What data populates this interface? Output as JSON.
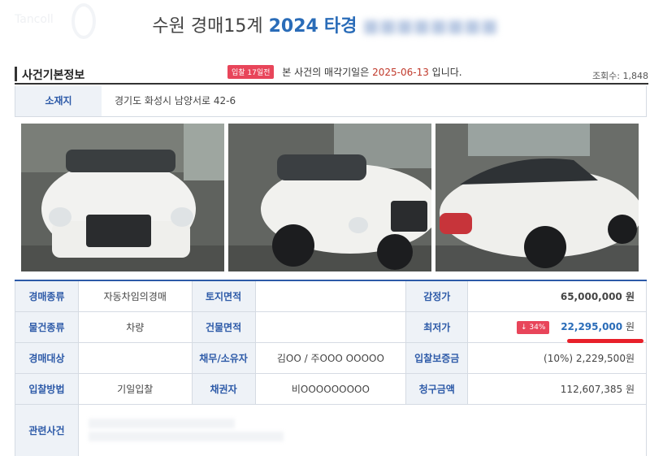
{
  "page": {
    "title_prefix": "수원 경매15계",
    "title_year": "2024",
    "title_suffix": "타경"
  },
  "header": {
    "section_title": "사건기본정보",
    "badge": "입찰 17일전",
    "notice_prefix": "본 사건의 매각기일은",
    "sale_date": "2025-06-13",
    "notice_suffix": "입니다.",
    "views": "조회수: 1,848"
  },
  "location": {
    "label": "소재지",
    "address": "경기도 화성시 남양서로 42-6"
  },
  "photos": [
    {
      "alt": "white car front view"
    },
    {
      "alt": "white car side front view"
    },
    {
      "alt": "white car rear view"
    }
  ],
  "details": {
    "auction_type_label": "경매종류",
    "auction_type": "자동차임의경매",
    "land_area_label": "토지면적",
    "land_area": "",
    "appraisal_label": "감정가",
    "appraisal": "65,000,000 원",
    "item_type_label": "물건종류",
    "item_type": "차량",
    "building_area_label": "건물면적",
    "building_area": "",
    "min_price_label": "최저가",
    "discount": "↓ 34%",
    "min_price": "22,295,000",
    "min_price_unit": "원",
    "target_label": "경매대상",
    "target": "",
    "debtor_label": "채무/소유자",
    "debtor": "김OO / 주OOO OOOOO",
    "deposit_label": "입찰보증금",
    "deposit": "(10%) 2,229,500원",
    "method_label": "입찰방법",
    "method": "기일입찰",
    "creditor_label": "채권자",
    "creditor": "비OOOOOOOOO",
    "claim_label": "청구금액",
    "claim": "112,607,385 원",
    "related_label": "관련사건"
  }
}
